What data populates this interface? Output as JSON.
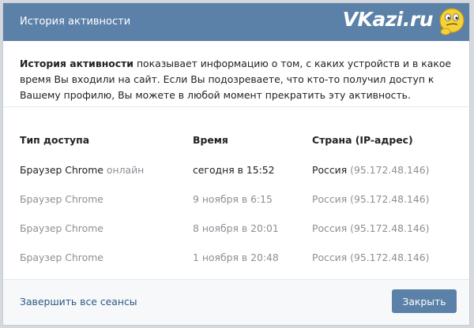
{
  "header": {
    "title": "История активности",
    "logo": "VKazi.ru"
  },
  "info": {
    "bold": "История активности",
    "rest": " показывает информацию о том, с каких устройств и в какое время Вы входили на сайт. Если Вы подозреваете, что кто-то получил доступ к Вашему профилю, Вы можете в любой момент прекратить эту активность."
  },
  "table": {
    "headers": [
      "Тип доступа",
      "Время",
      "Страна (IP-адрес)"
    ],
    "rows": [
      {
        "access": "Браузер Chrome",
        "status": "онлайн",
        "time": "сегодня в 15:52",
        "country": "Россия",
        "ip": "(95.172.48.146)"
      },
      {
        "access": "Браузер Chrome",
        "status": "",
        "time": "9 ноября в 6:15",
        "country": "Россия",
        "ip": "(95.172.48.146)"
      },
      {
        "access": "Браузер Chrome",
        "status": "",
        "time": "8 ноября в 20:01",
        "country": "Россия",
        "ip": "(95.172.48.146)"
      },
      {
        "access": "Браузер Chrome",
        "status": "",
        "time": "1 ноября в 20:48",
        "country": "Россия",
        "ip": "(95.172.48.146)"
      }
    ]
  },
  "footer": {
    "end_sessions": "Завершить все сеансы",
    "close": "Закрыть"
  },
  "colors": {
    "header": "#5b81a8",
    "link": "#2a5885",
    "muted": "#8a9096"
  }
}
